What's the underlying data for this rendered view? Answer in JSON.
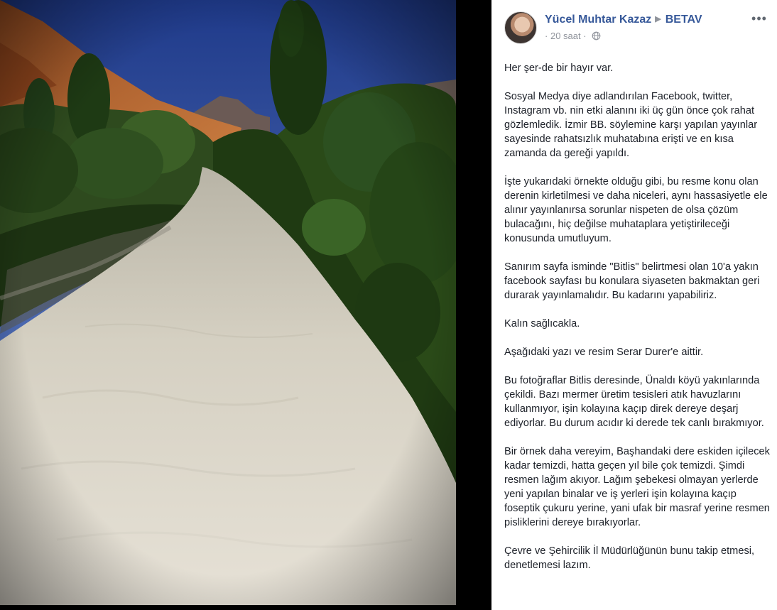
{
  "post": {
    "author": "Yücel Muhtar Kazaz",
    "separator": "▶",
    "group": "BETAV",
    "time": "20 saat",
    "dot": "·",
    "more": "•••",
    "paragraphs": [
      "Her şer-de bir hayır var.",
      "Sosyal Medya diye adlandırılan Facebook, twitter, Instagram vb. nin etki alanını iki üç gün önce çok rahat gözlemledik. İzmir BB. söylemine karşı yapılan yayınlar sayesinde rahatsızlık muhatabına erişti ve en kısa zamanda da gereği yapıldı.",
      "İşte yukarıdaki örnekte olduğu gibi, bu resme konu olan derenin kirletilmesi ve daha niceleri, aynı hassasiyetle ele alınır yayınlanırsa sorunlar nispeten de olsa çözüm bulacağını, hiç değilse muhataplara yetiştirileceği konusunda umutluyum.",
      "Sanırım sayfa isminde \"Bitlis\" belirtmesi olan 10'a yakın facebook sayfası bu konulara siyaseten bakmaktan geri durarak yayınlamalıdır. Bu kadarını yapabiliriz.",
      "Kalın sağlıcakla.",
      "Aşağıdaki yazı ve resim Serar Durer'e aittir.",
      "Bu fotoğraflar Bitlis deresinde, Ünaldı köyü yakınlarında çekildi. Bazı mermer üretim tesisleri atık havuzlarını kullanmıyor, işin kolayına kaçıp direk dereye deşarj ediyorlar. Bu durum acıdır ki derede tek canlı bırakmıyor.",
      "Bir örnek daha vereyim, Başhandaki dere eskiden içilecek kadar temizdi, hatta geçen yıl bile çok temizdi. Şimdi resmen lağım akıyor. Lağım şebekesi olmayan yerlerde yeni yapılan binalar ve iş yerleri işin kolayına kaçıp foseptik çukuru yerine, yani ufak bir masraf yerine resmen pisliklerini dereye bırakıyorlar.",
      "Çevre ve Şehircilik İl Müdürlüğünün bunu takip etmesi, denetlemesi lazım."
    ]
  },
  "icons": {
    "globe": "globe-icon",
    "avatar": "profile-photo",
    "more": "more-options-icon"
  },
  "colors": {
    "link": "#365899",
    "meta": "#90949c",
    "text": "#1d2129",
    "lightbox_bg": "#000000"
  }
}
